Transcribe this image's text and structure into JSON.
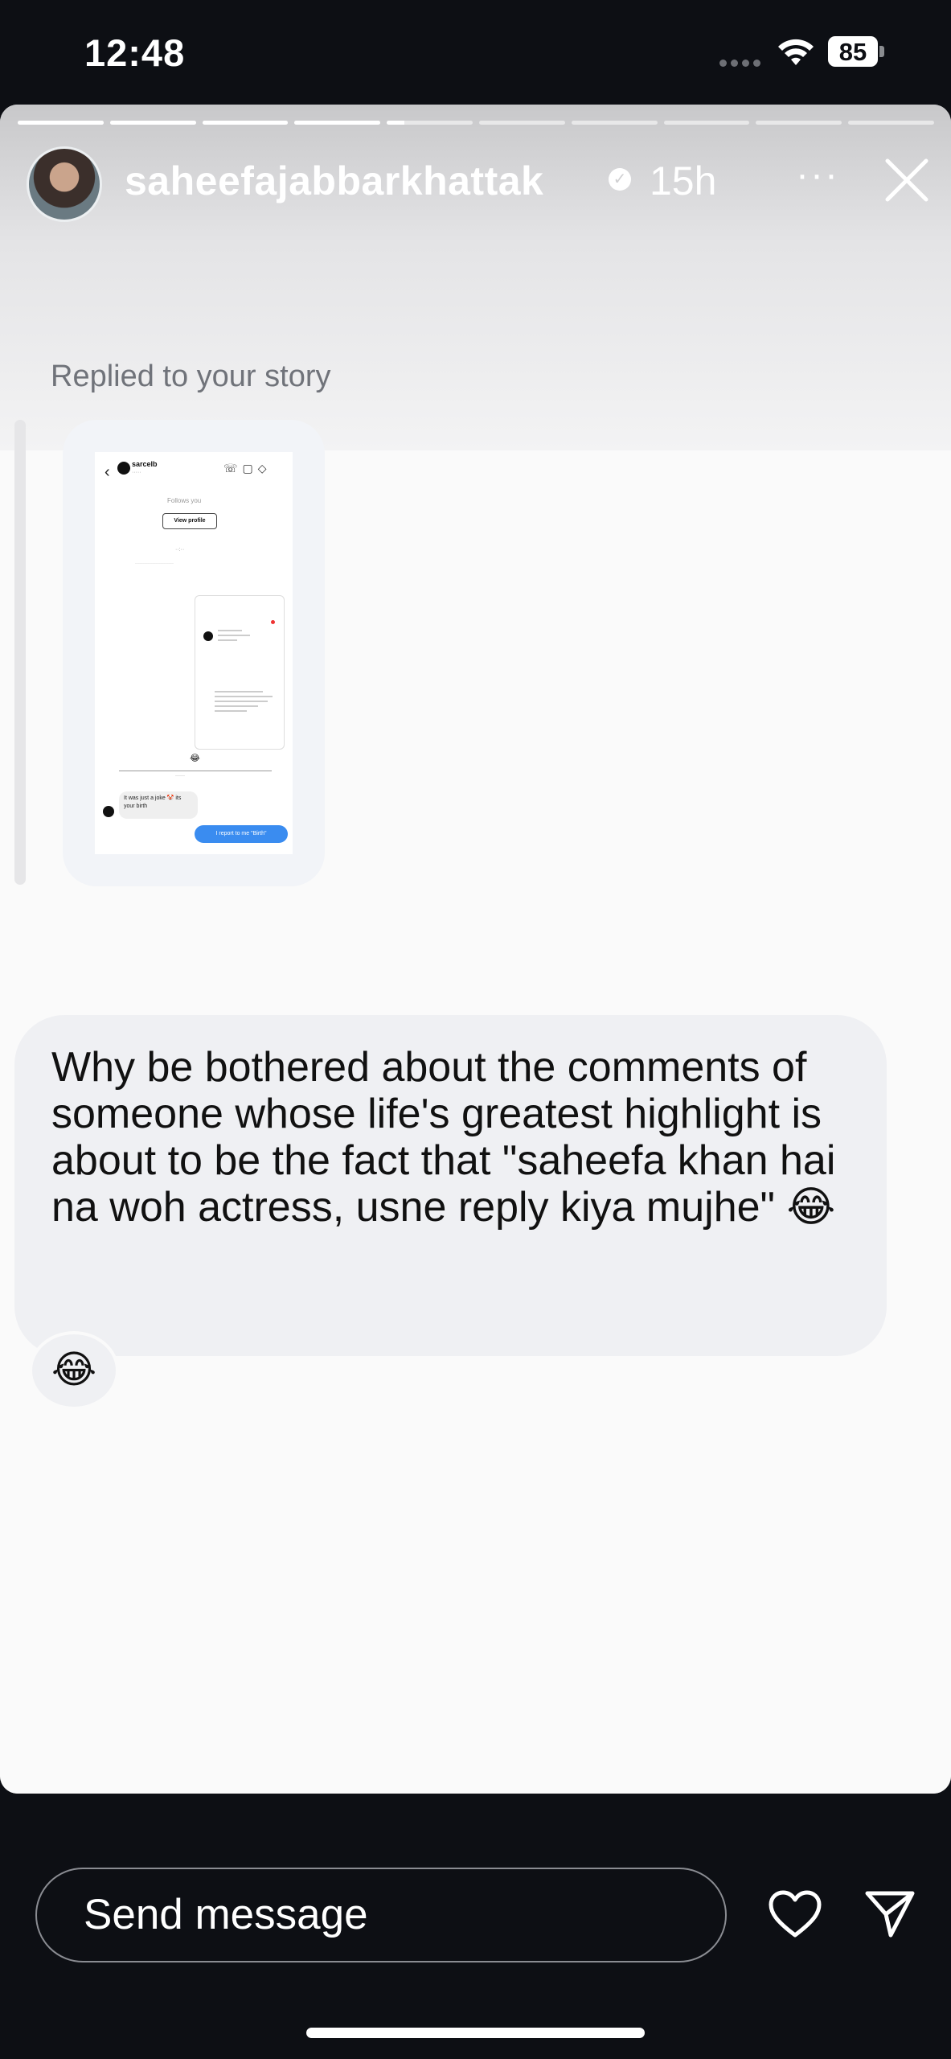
{
  "status_bar": {
    "time": "12:48",
    "battery": "85"
  },
  "story": {
    "username": "saheefajabbarkhattak",
    "time_ago": "15h",
    "more_label": "···",
    "progress": {
      "segments": 10,
      "completed": 4,
      "current_fraction": 0.2
    }
  },
  "reply": {
    "label": "Replied to your story",
    "thumbnail": {
      "name": "sarcelb",
      "follows_you": "Follows you",
      "view_profile": "View profile",
      "incoming": "It was just a joke 🤡 its your birth",
      "outgoing": "I report to me \"Birth\""
    },
    "message": "Why be bothered about the comments of someone whose life's greatest highlight is about to be the fact that \"saheefa khan hai na woh actress, usne reply kiya mujhe\" 😂",
    "reaction": "😂"
  },
  "bottom_bar": {
    "placeholder": "Send message"
  },
  "icons": [
    "wifi-icon",
    "battery-icon",
    "verified-badge-icon",
    "more-icon",
    "close-icon",
    "heart-icon",
    "send-icon"
  ]
}
